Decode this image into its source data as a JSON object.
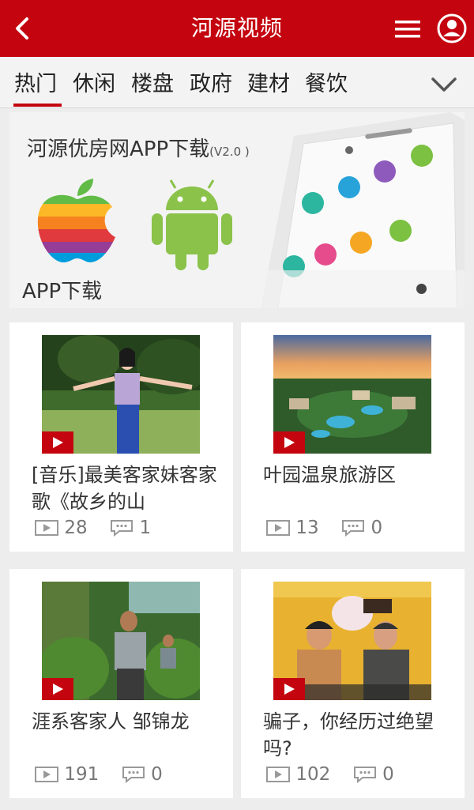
{
  "header": {
    "title": "河源视频",
    "back_icon": "chevron-left-icon",
    "menu_icon": "hamburger-menu-icon",
    "user_icon": "user-circle-icon",
    "color": "#c4050f"
  },
  "tabs": [
    {
      "label": "热门",
      "active": true
    },
    {
      "label": "休闲"
    },
    {
      "label": "楼盘"
    },
    {
      "label": "政府"
    },
    {
      "label": "建材"
    },
    {
      "label": "餐饮"
    }
  ],
  "banner": {
    "title": "河源优房网APP下载",
    "version": "(V2.0 )",
    "subtitle": "APP下载"
  },
  "videos": [
    {
      "title": "[音乐]最美客家妹客家歌《故乡的山",
      "views": "28",
      "comments": "1"
    },
    {
      "title": "叶园温泉旅游区",
      "views": "13",
      "comments": "0"
    },
    {
      "title": "涯系客家人 邹锦龙",
      "views": "191",
      "comments": "0"
    },
    {
      "title": "骗子，你经历过绝望吗?",
      "views": "102",
      "comments": "0"
    }
  ]
}
